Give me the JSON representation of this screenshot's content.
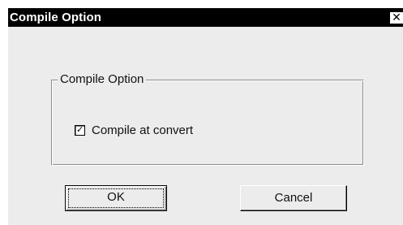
{
  "window": {
    "title": "Compile Option",
    "close_glyph": "✕"
  },
  "group": {
    "label": "Compile Option"
  },
  "checkbox": {
    "label": "Compile at convert",
    "checked": true,
    "mark": "✓"
  },
  "buttons": {
    "ok_label": "OK",
    "cancel_label": "Cancel"
  },
  "colors": {
    "titlebar": "#000000",
    "dialog_background": "#ececec"
  }
}
